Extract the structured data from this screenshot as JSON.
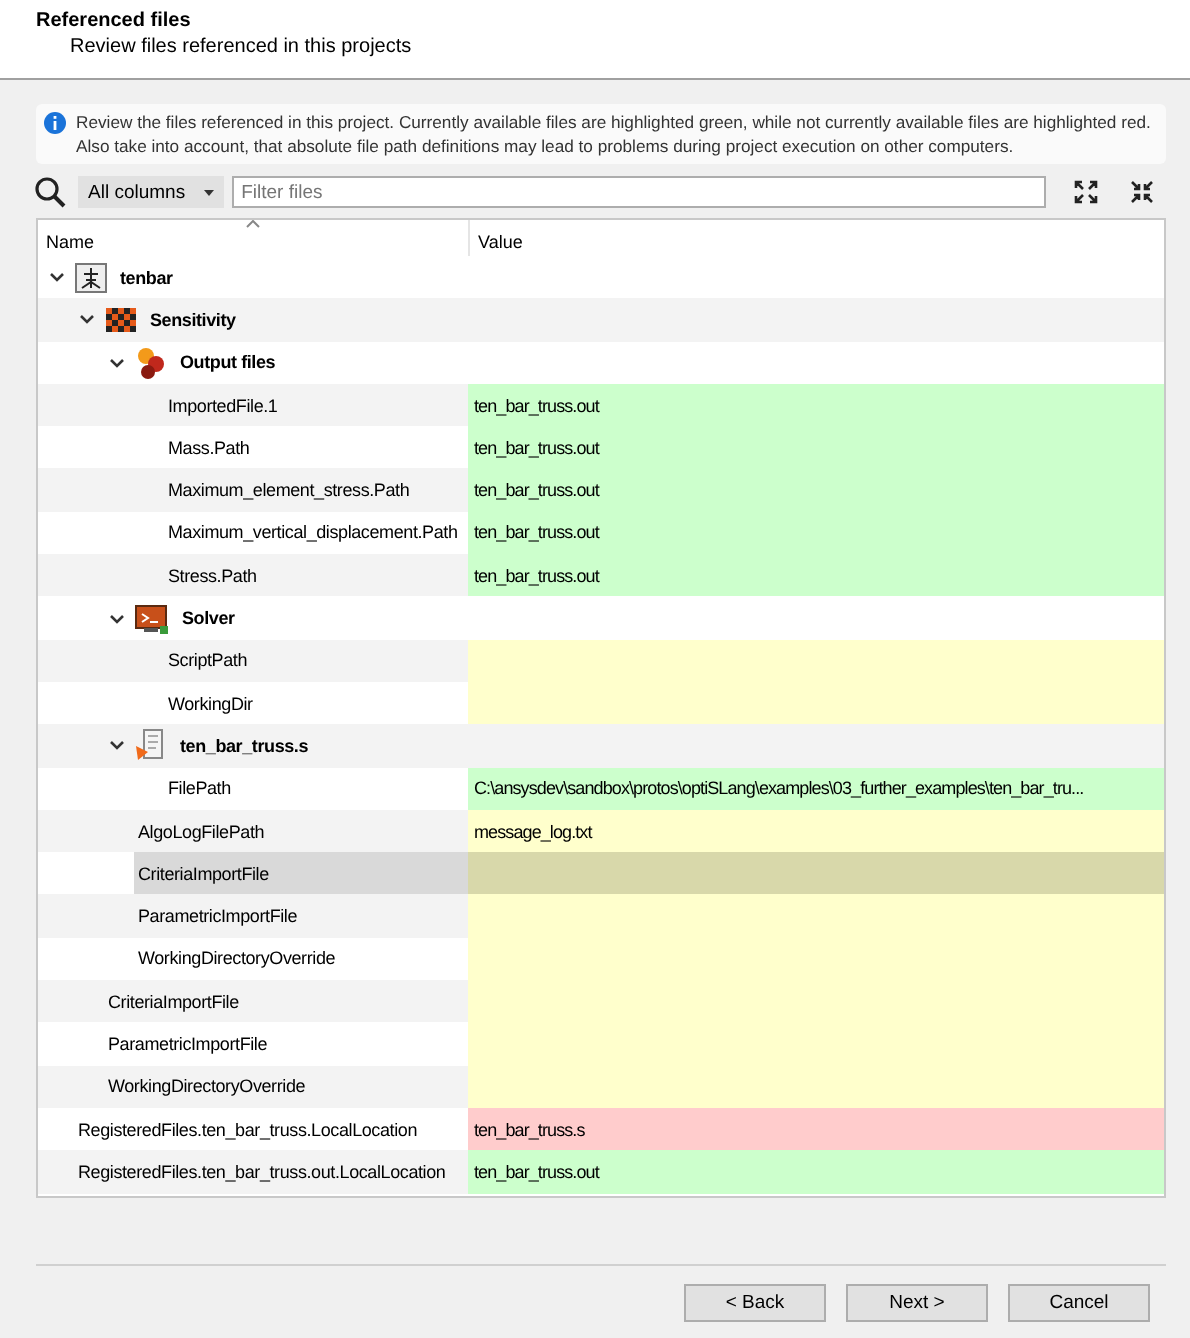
{
  "header": {
    "title": "Referenced files",
    "subtitle": "Review files referenced in this projects"
  },
  "info": "Review the files referenced in this project. Currently available files are highlighted green, while not currently available files are highlighted red. Also take into account, that absolute file path definitions may lead to problems during project execution on other computers.",
  "filter": {
    "scope": "All columns",
    "placeholder": "Filter files"
  },
  "table": {
    "columns": [
      "Name",
      "Value"
    ],
    "rows": [
      {
        "name": "tenbar",
        "kind": "project",
        "expanded": true,
        "selected": false,
        "children": [
          {
            "name": "Sensitivity",
            "kind": "sensitivity",
            "expanded": true,
            "selected": false,
            "children": [
              {
                "name": "Output files",
                "kind": "output",
                "expanded": true,
                "selected": false,
                "children": [
                  {
                    "name": "ImportedFile.1",
                    "value": "ten_bar_truss.out",
                    "color": "#ccffcc",
                    "selected": false
                  },
                  {
                    "name": "Mass.Path",
                    "value": "ten_bar_truss.out",
                    "color": "#ccffcc",
                    "selected": false
                  },
                  {
                    "name": "Maximum_element_stress.Path",
                    "value": "ten_bar_truss.out",
                    "color": "#ccffcc",
                    "selected": false
                  },
                  {
                    "name": "Maximum_vertical_displacement.Path",
                    "value": "ten_bar_truss.out",
                    "color": "#ccffcc",
                    "selected": false
                  },
                  {
                    "name": "Stress.Path",
                    "value": "ten_bar_truss.out",
                    "color": "#ccffcc",
                    "selected": false
                  }
                ]
              },
              {
                "name": "Solver",
                "kind": "solver",
                "expanded": true,
                "selected": false,
                "children": [
                  {
                    "name": "ScriptPath",
                    "color": "#ffffcc",
                    "selected": false
                  },
                  {
                    "name": "WorkingDir",
                    "color": "#ffffcc",
                    "selected": false
                  }
                ]
              },
              {
                "name": "ten_bar_truss.s",
                "kind": "script",
                "expanded": true,
                "selected": false,
                "children": [
                  {
                    "name": "FilePath",
                    "value": "C:\\ansysdev\\sandbox\\protos\\optiSLang\\examples\\03_further_examples\\ten_bar_tru...",
                    "color": "#ccffcc",
                    "selected": false
                  }
                ]
              },
              {
                "name": "AlgoLogFilePath",
                "value": "message_log.txt",
                "color": "#ffffcc",
                "selected": false
              },
              {
                "name": "CriteriaImportFile",
                "color": "#d8d8aa",
                "selected": true
              },
              {
                "name": "ParametricImportFile",
                "color": "#ffffcc",
                "selected": false
              },
              {
                "name": "WorkingDirectoryOverride",
                "color": "#ffffcc",
                "selected": false
              }
            ]
          },
          {
            "name": "CriteriaImportFile",
            "color": "#ffffcc",
            "selected": false
          },
          {
            "name": "ParametricImportFile",
            "color": "#ffffcc",
            "selected": false
          },
          {
            "name": "WorkingDirectoryOverride",
            "color": "#ffffcc",
            "selected": false
          }
        ]
      },
      {
        "name": "RegisteredFiles.ten_bar_truss.LocalLocation",
        "value": "ten_bar_truss.s",
        "color": "#ffcccc",
        "selected": false
      },
      {
        "name": "RegisteredFiles.ten_bar_truss.out.LocalLocation",
        "value": "ten_bar_truss.out",
        "color": "#ccffcc",
        "selected": false
      }
    ]
  },
  "buttons": [
    "< Back",
    "Next >",
    "Cancel"
  ]
}
